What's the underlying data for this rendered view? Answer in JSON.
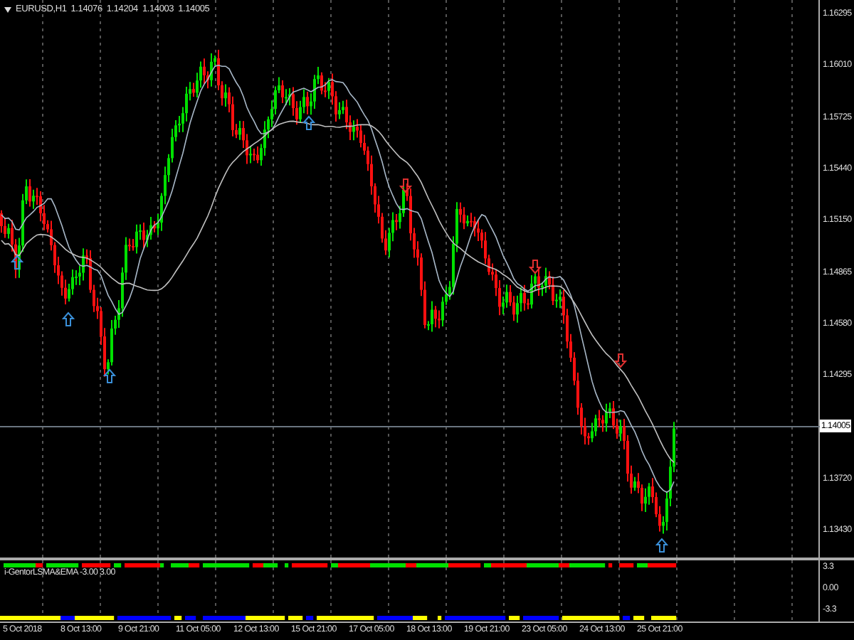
{
  "header": {
    "symbol": "EURUSD,H1",
    "quotes": [
      "1.14076",
      "1.14204",
      "1.14003",
      "1.14005"
    ]
  },
  "price_axis": {
    "labels": [
      {
        "kind": "tick",
        "text": "1.16295"
      },
      {
        "kind": "tick",
        "text": "1.16010"
      },
      {
        "kind": "tick",
        "text": "1.15725"
      },
      {
        "kind": "tick",
        "text": "1.15440"
      },
      {
        "kind": "tick",
        "text": "1.15150"
      },
      {
        "kind": "tick",
        "text": "1.14865"
      },
      {
        "kind": "tick",
        "text": "1.14580"
      },
      {
        "kind": "tick",
        "text": "1.14295"
      },
      {
        "kind": "current",
        "text": "1.14005"
      },
      {
        "kind": "tick",
        "text": "1.13720"
      },
      {
        "kind": "tick",
        "text": "1.13430"
      }
    ]
  },
  "indicator": {
    "label": "i-GentorLSMA&EMA -3.00 3.00",
    "axis_labels": [
      "3.3",
      "0.00",
      "-3.3"
    ]
  },
  "time_axis": {
    "labels": [
      "5 Oct 2018",
      "8 Oct 13:00",
      "9 Oct 21:00",
      "11 Oct 05:00",
      "12 Oct 13:00",
      "15 Oct 21:00",
      "17 Oct 05:00",
      "18 Oct 13:00",
      "19 Oct 21:00",
      "23 Oct 05:00",
      "24 Oct 13:00",
      "25 Oct 21:00"
    ]
  }
}
